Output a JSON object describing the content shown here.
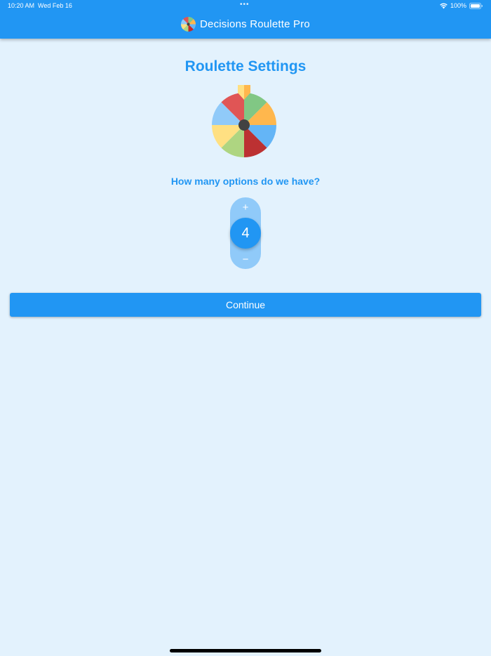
{
  "status_bar": {
    "time": "10:20 AM",
    "date": "Wed Feb 16",
    "dots": "•••",
    "battery_text": "100%",
    "wifi_icon": "wifi-icon",
    "battery_icon": "battery-icon"
  },
  "app_bar": {
    "title": "Decisions Roulette Pro",
    "logo_icon": "roulette-wheel-icon",
    "background_color": "#2196F3"
  },
  "main": {
    "title": "Roulette Settings",
    "wheel_icon": "roulette-wheel-icon",
    "question": "How many options do we have?",
    "stepper": {
      "increment_label": "+",
      "value": "4",
      "decrement_label": "−"
    },
    "continue_label": "Continue"
  },
  "colors": {
    "accent": "#2196F3",
    "background": "#E3F2FD",
    "stepper_track": "#90CAF9"
  }
}
